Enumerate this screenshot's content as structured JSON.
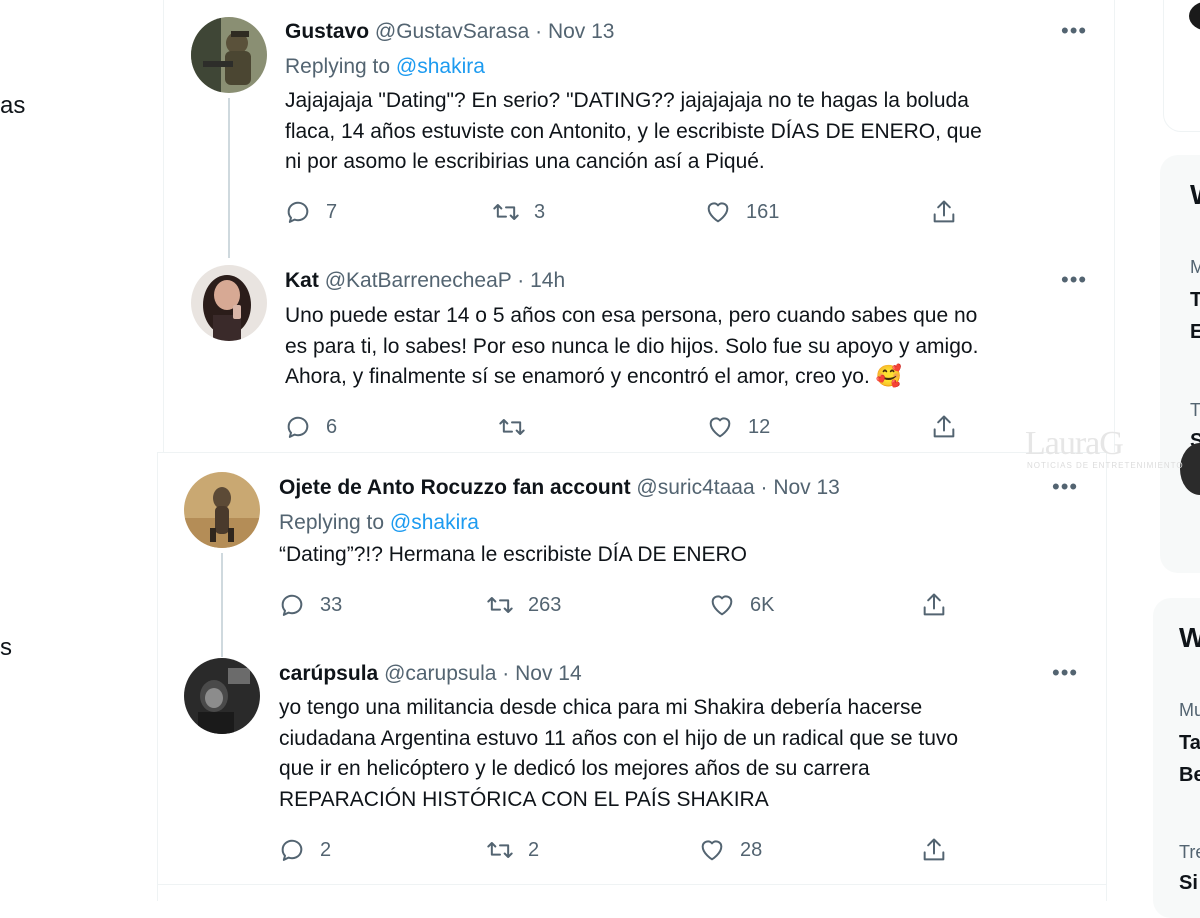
{
  "left_nav": {
    "fragment_1": "as",
    "fragment_2": "s"
  },
  "tweets": [
    {
      "name": "Gustavo",
      "handle": "@GustavSarasa",
      "time": "Nov 13",
      "replying_prefix": "Replying to",
      "replying_to": "@shakira",
      "lines": [
        "Jajajajaja \"Dating\"? En serio? \"DATING?? jajajajaja no te hagas la boluda",
        "flaca, 14 años estuviste con Antonito, y le escribiste DÍAS DE ENERO, que",
        "ni por asomo le escribirias una canción así a Piqué."
      ],
      "replies": "7",
      "retweets": "3",
      "likes": "161"
    },
    {
      "name": "Kat",
      "handle": "@KatBarrenecheaP",
      "time": "14h",
      "lines": [
        "Uno puede estar 14 o 5 años con esa persona, pero cuando sabes que no",
        "es para ti, lo sabes! Por eso nunca le dio hijos. Solo fue su apoyo y amigo.",
        "Ahora, y finalmente sí se enamoró y encontró el amor, creo yo. 🥰"
      ],
      "replies": "6",
      "retweets": "",
      "likes": "12"
    },
    {
      "name": "Ojete de Anto Rocuzzo fan account",
      "handle": "@suric4taaa",
      "time": "Nov 13",
      "replying_prefix": "Replying to",
      "replying_to": "@shakira",
      "lines": [
        "“Dating”?!? Hermana le escribiste DÍA DE ENERO"
      ],
      "replies": "33",
      "retweets": "263",
      "likes": "6K"
    },
    {
      "name": "carúpsula",
      "handle": "@carupsula",
      "time": "Nov 14",
      "lines": [
        "yo tengo una militancia desde chica para mi Shakira debería hacerse",
        "ciudadana Argentina estuvo 11 años con el hijo de un radical que se tuvo",
        "que ir en helicóptero y le dedicó los mejores años de su carrera",
        "REPARACIÓN HISTÓRICA CON EL PAÍS SHAKIRA"
      ],
      "replies": "2",
      "retweets": "2",
      "likes": "28"
    }
  ],
  "sidebar": {
    "card1_heading": "W",
    "card1_items": [
      {
        "label": "M",
        "title_1": "T",
        "title_2": "E"
      },
      {
        "label": "T",
        "title_1": "S"
      }
    ],
    "card2_heading": "W",
    "card2_items": [
      {
        "label": "Mu",
        "title_1": "Ta",
        "title_2": "Be"
      },
      {
        "label": "Tre",
        "title_1": "Si"
      }
    ]
  },
  "watermark": {
    "text": "LauraG",
    "subtext": "NOTICIAS DE ENTRETENIMIENTO"
  },
  "colors": {
    "accent": "#1d9bf0",
    "muted": "#536471",
    "text": "#0f1419",
    "thread_line": "#cfd9de"
  }
}
